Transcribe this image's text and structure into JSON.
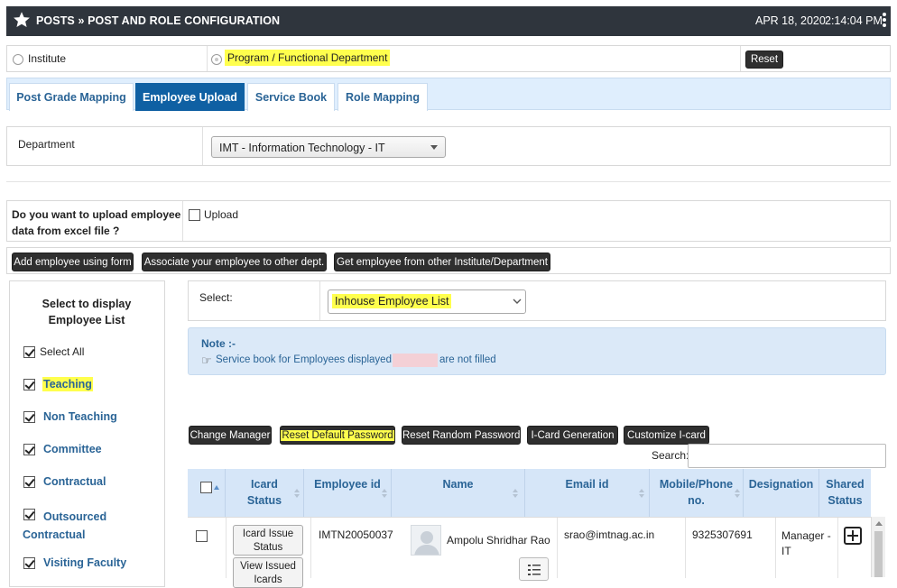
{
  "header": {
    "title": "POSTS » POST AND ROLE CONFIGURATION",
    "date": "APR 18, 2020",
    "time": "2:14:04 PM"
  },
  "scope": {
    "institute_label": "Institute",
    "program_label": "Program / Functional Department",
    "reset_label": "Reset"
  },
  "tabs": [
    {
      "label": "Post Grade Mapping"
    },
    {
      "label": "Employee Upload"
    },
    {
      "label": "Service Book"
    },
    {
      "label": "Role Mapping"
    }
  ],
  "department": {
    "label": "Department",
    "value": "IMT - Information Technology - IT"
  },
  "upload": {
    "question": "Do you want to upload employee data from excel file ?",
    "checkbox_label": "Upload"
  },
  "actions": {
    "add_form": "Add employee using form",
    "associate": "Associate your employee to other dept.",
    "get_other": "Get employee from other Institute/Department"
  },
  "filter": {
    "heading": "Select to display Employee List",
    "select_all": "Select All",
    "items": [
      "Teaching",
      "Non Teaching",
      "Committee",
      "Contractual",
      "Outsourced Contractual",
      "Visiting Faculty"
    ]
  },
  "list_select": {
    "label": "Select:",
    "value": "Inhouse Employee List"
  },
  "note": {
    "title": "Note :-",
    "text_before": "Service book for Employees displayed in",
    "text_after": "are not filled",
    "highlight_color": "#f4d0d6"
  },
  "toolbar": {
    "change_manager": "Change Manager",
    "reset_default": "Reset Default Password",
    "reset_random": "Reset Random Password",
    "icard_generation": "I-Card Generation",
    "customize_icard": "Customize I-card"
  },
  "search": {
    "label": "Search:",
    "value": ""
  },
  "table": {
    "columns": [
      "Icard Status",
      "Employee id",
      "Name",
      "Email id",
      "Mobile/Phone no.",
      "Designation",
      "Shared Status"
    ],
    "rows": [
      {
        "icard_btn": "Icard Issue Status",
        "view_btn": "View Issued Icards",
        "employee_id": "IMTN20050037",
        "name": "Ampolu Shridhar Rao",
        "email": "srao@imtnag.ac.in",
        "mobile": "9325307691",
        "designation": "Manager - IT"
      }
    ]
  },
  "colors": {
    "header_bg": "#2f353d",
    "tab_active": "#0f60a3",
    "link_blue": "#2a6496",
    "highlight": "#ffff4d",
    "note_bg": "#dbe9f8"
  }
}
